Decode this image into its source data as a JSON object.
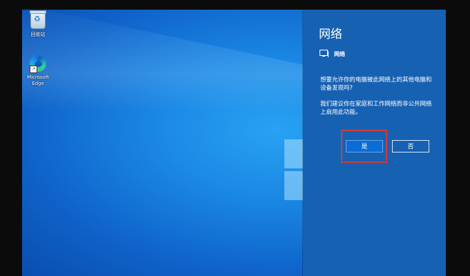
{
  "desktop": {
    "icons": [
      {
        "label": "回收站",
        "icon": "recycle-bin-icon"
      },
      {
        "label": "Microsoft Edge",
        "icon": "edge-icon"
      }
    ]
  },
  "network_panel": {
    "title": "网络",
    "network_name": "网络",
    "network_icon": "monitor-network-icon",
    "question": "想要允许你的电脑被此网络上的其他电脑和设备发现吗?",
    "recommendation": "我们建议你在家庭和工作网络而非公共网络上启用此功能。",
    "yes_label": "是",
    "no_label": "否"
  },
  "colors": {
    "panel_background": "#1761b3",
    "yes_button": "#0a6cd7",
    "highlight": "#d23a3a"
  }
}
